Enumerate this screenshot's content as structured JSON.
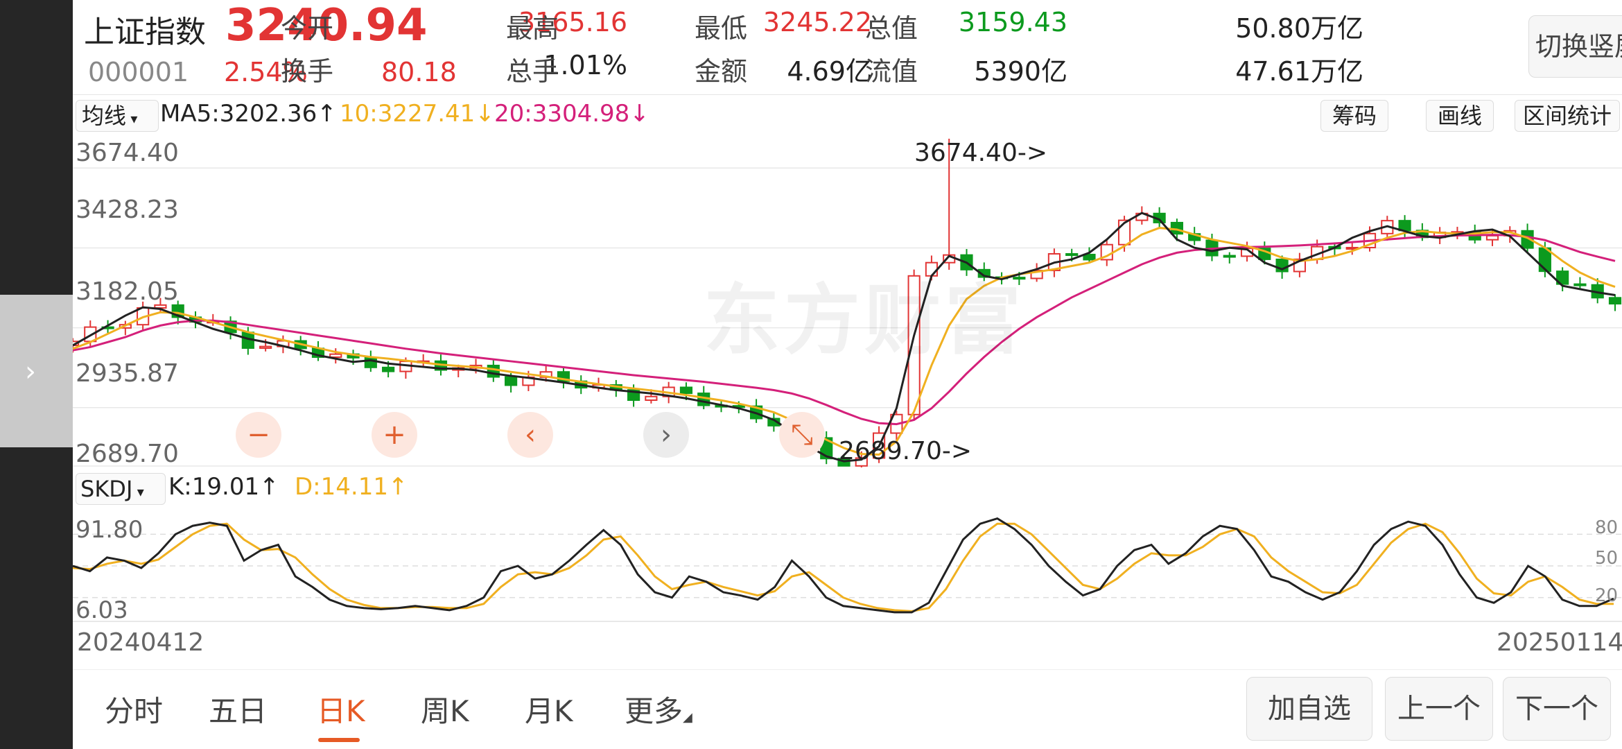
{
  "header": {
    "name": "上证指数",
    "code": "000001",
    "price": "3240.94",
    "change_pct": "2.54%",
    "change": "80.18",
    "stats": [
      {
        "label": "今开",
        "value": "3165.16",
        "color": "#e23434"
      },
      {
        "label": "最高",
        "value": "3245.22",
        "color": "#e23434"
      },
      {
        "label": "最低",
        "value": "3159.43",
        "color": "#0c9a1e"
      },
      {
        "label": "总值",
        "value": "50.80万亿",
        "color": "#222222"
      },
      {
        "label": "换手",
        "value": "1.01%",
        "color": "#222222"
      },
      {
        "label": "总手",
        "value": "4.69亿",
        "color": "#222222"
      },
      {
        "label": "金额",
        "value": "5390亿",
        "color": "#222222"
      },
      {
        "label": "流值",
        "value": "47.61万亿",
        "color": "#222222"
      }
    ],
    "switch_button": "切换竖屏"
  },
  "ma_bar": {
    "selector": "均线",
    "ma5": "MA5:3202.36↑",
    "ma10": "10:3227.41↓",
    "ma20": "20:3304.98↓",
    "buttons": [
      "筹码",
      "画线",
      "区间统计"
    ]
  },
  "main_chart": {
    "yticks": [
      "3674.40",
      "3428.23",
      "3182.05",
      "2935.87",
      "2689.70"
    ],
    "high_annotation": "3674.40->",
    "low_annotation": "2689.70->",
    "watermark": "东方财富"
  },
  "zoom_controls": [
    "−",
    "+",
    "‹",
    "›",
    "⤡"
  ],
  "sub_bar": {
    "selector": "SKDJ",
    "k": "K:19.01↑",
    "d": "D:14.11↑"
  },
  "sub_chart": {
    "left_ticks": [
      "91.80",
      "6.03"
    ],
    "right_ticks": [
      "80",
      "50",
      "20"
    ]
  },
  "dates": {
    "start": "20240412",
    "end": "20250114"
  },
  "tabs": [
    "分时",
    "五日",
    "日K",
    "周K",
    "月K",
    "更多"
  ],
  "active_tab": 2,
  "bottom_buttons": [
    "加自选",
    "上一个",
    "下一个"
  ],
  "colors": {
    "up": "#e23434",
    "down": "#0c9a1e",
    "ma5": "#222222",
    "ma10": "#f0b020",
    "ma20": "#d4207a",
    "accent": "#e65a25"
  },
  "chart_data": {
    "type": "candlestick",
    "title": "",
    "x_range": [
      "20240412",
      "20250114"
    ],
    "ylim": [
      2689.7,
      3674.4
    ],
    "ma5_path": [
      3050,
      3080,
      3110,
      3140,
      3165,
      3160,
      3140,
      3120,
      3100,
      3085,
      3070,
      3060,
      3048,
      3035,
      3020,
      3010,
      3000,
      3005,
      2995,
      2990,
      2985,
      2980,
      2980,
      2975,
      2965,
      2958,
      2952,
      2945,
      2938,
      2930,
      2922,
      2915,
      2910,
      2905,
      2898,
      2890,
      2880,
      2870,
      2860,
      2845,
      2825,
      2790,
      2745,
      2715,
      2700,
      2705,
      2745,
      2860,
      3080,
      3260,
      3320,
      3300,
      3260,
      3250,
      3265,
      3280,
      3300,
      3310,
      3330,
      3370,
      3420,
      3450,
      3430,
      3370,
      3345,
      3335,
      3345,
      3340,
      3300,
      3280,
      3305,
      3325,
      3345,
      3375,
      3395,
      3410,
      3395,
      3380,
      3375,
      3385,
      3395,
      3400,
      3380,
      3330,
      3280,
      3230,
      3220,
      3210,
      3202
    ],
    "ma10_path": [
      3040,
      3060,
      3085,
      3110,
      3135,
      3150,
      3148,
      3135,
      3120,
      3105,
      3090,
      3078,
      3066,
      3054,
      3042,
      3030,
      3022,
      3015,
      3010,
      3004,
      2998,
      2992,
      2988,
      2984,
      2978,
      2970,
      2963,
      2956,
      2948,
      2940,
      2933,
      2926,
      2920,
      2914,
      2907,
      2900,
      2892,
      2884,
      2874,
      2862,
      2848,
      2825,
      2795,
      2765,
      2740,
      2722,
      2720,
      2760,
      2850,
      2990,
      3110,
      3190,
      3230,
      3255,
      3265,
      3272,
      3280,
      3290,
      3300,
      3320,
      3350,
      3385,
      3405,
      3400,
      3385,
      3370,
      3360,
      3350,
      3335,
      3315,
      3305,
      3310,
      3320,
      3335,
      3355,
      3375,
      3390,
      3395,
      3390,
      3388,
      3388,
      3392,
      3392,
      3375,
      3345,
      3305,
      3270,
      3245,
      3227
    ],
    "ma20_path": [
      3035,
      3045,
      3060,
      3075,
      3095,
      3110,
      3120,
      3125,
      3125,
      3120,
      3112,
      3104,
      3096,
      3088,
      3080,
      3072,
      3064,
      3056,
      3048,
      3040,
      3033,
      3026,
      3020,
      3014,
      3008,
      3002,
      2996,
      2990,
      2984,
      2978,
      2972,
      2966,
      2960,
      2955,
      2950,
      2945,
      2940,
      2934,
      2928,
      2922,
      2915,
      2905,
      2890,
      2870,
      2848,
      2828,
      2815,
      2812,
      2825,
      2860,
      2910,
      2965,
      3015,
      3060,
      3100,
      3135,
      3165,
      3195,
      3220,
      3245,
      3270,
      3295,
      3315,
      3330,
      3338,
      3342,
      3345,
      3347,
      3348,
      3350,
      3352,
      3355,
      3358,
      3362,
      3366,
      3370,
      3374,
      3378,
      3380,
      3382,
      3383,
      3384,
      3383,
      3378,
      3368,
      3350,
      3332,
      3318,
      3305
    ],
    "skdj_k": [
      50,
      45,
      58,
      55,
      48,
      62,
      80,
      88,
      91,
      88,
      55,
      65,
      70,
      40,
      30,
      18,
      12,
      10,
      9,
      10,
      12,
      10,
      8,
      12,
      20,
      45,
      50,
      38,
      42,
      55,
      70,
      84,
      70,
      42,
      25,
      20,
      40,
      35,
      25,
      22,
      18,
      30,
      55,
      40,
      20,
      12,
      10,
      8,
      6,
      6,
      15,
      45,
      75,
      90,
      95,
      85,
      70,
      50,
      35,
      22,
      28,
      50,
      65,
      70,
      52,
      62,
      78,
      88,
      85,
      65,
      40,
      35,
      25,
      18,
      25,
      45,
      70,
      85,
      92,
      88,
      70,
      42,
      20,
      15,
      25,
      50,
      40,
      18,
      12,
      12,
      19
    ],
    "skdj_d": [
      48,
      47,
      52,
      55,
      52,
      56,
      68,
      80,
      88,
      90,
      75,
      65,
      66,
      58,
      42,
      28,
      18,
      13,
      10,
      10,
      11,
      11,
      10,
      10,
      14,
      30,
      42,
      44,
      42,
      48,
      60,
      75,
      78,
      60,
      40,
      28,
      32,
      35,
      30,
      26,
      22,
      26,
      40,
      44,
      32,
      20,
      14,
      10,
      8,
      7,
      10,
      28,
      55,
      78,
      90,
      90,
      80,
      64,
      48,
      32,
      28,
      38,
      52,
      62,
      60,
      60,
      68,
      80,
      85,
      78,
      58,
      45,
      35,
      25,
      24,
      32,
      52,
      72,
      85,
      90,
      82,
      62,
      38,
      24,
      22,
      35,
      40,
      30,
      18,
      14,
      14
    ]
  }
}
